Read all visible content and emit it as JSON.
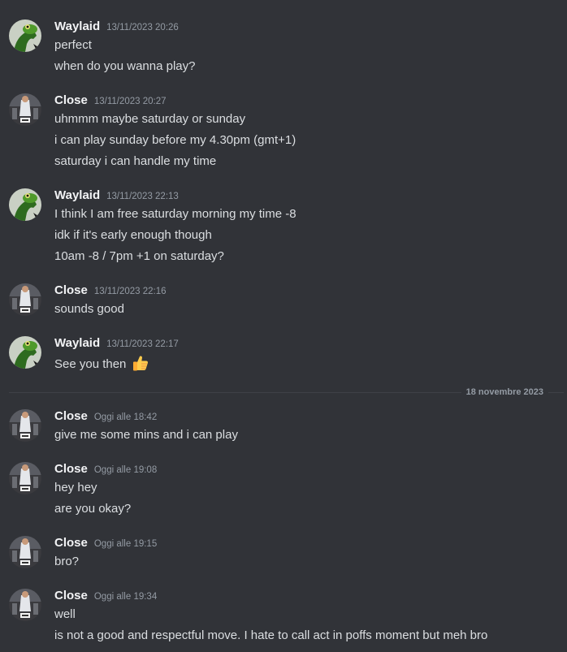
{
  "messages": [
    {
      "author": "Waylaid",
      "timestamp": "13/11/2023 20:26",
      "lines": [
        "perfect",
        "when do you wanna play?"
      ]
    },
    {
      "author": "Close",
      "timestamp": "13/11/2023 20:27",
      "lines": [
        "uhmmm maybe saturday or sunday",
        "i can play sunday before my 4.30pm (gmt+1)",
        "saturday i can handle my time"
      ]
    },
    {
      "author": "Waylaid",
      "timestamp": "13/11/2023 22:13",
      "lines": [
        "I think I am free saturday morning my time -8",
        "idk if it's early enough though",
        "10am -8 / 7pm +1 on saturday?"
      ]
    },
    {
      "author": "Close",
      "timestamp": "13/11/2023 22:16",
      "lines": [
        "sounds good"
      ]
    },
    {
      "author": "Waylaid",
      "timestamp": "13/11/2023 22:17",
      "lines": [
        "See you then"
      ],
      "emoji": "thumbs-up"
    },
    {
      "author": "Close",
      "timestamp": "Oggi alle 18:42",
      "lines": [
        "give me some mins and i can play"
      ]
    },
    {
      "author": "Close",
      "timestamp": "Oggi alle 19:08",
      "lines": [
        "hey hey",
        "are you okay?"
      ]
    },
    {
      "author": "Close",
      "timestamp": "Oggi alle 19:15",
      "lines": [
        "bro?"
      ]
    },
    {
      "author": "Close",
      "timestamp": "Oggi alle 19:34",
      "lines": [
        "well",
        "is not a good and respectful move. I hate to call act in poffs moment but meh bro"
      ]
    }
  ],
  "date_divider": "18 novembre 2023",
  "colors": {
    "background": "#313338",
    "username": "#f2f3f5",
    "text": "#dbdee1",
    "muted": "#949ba4"
  }
}
